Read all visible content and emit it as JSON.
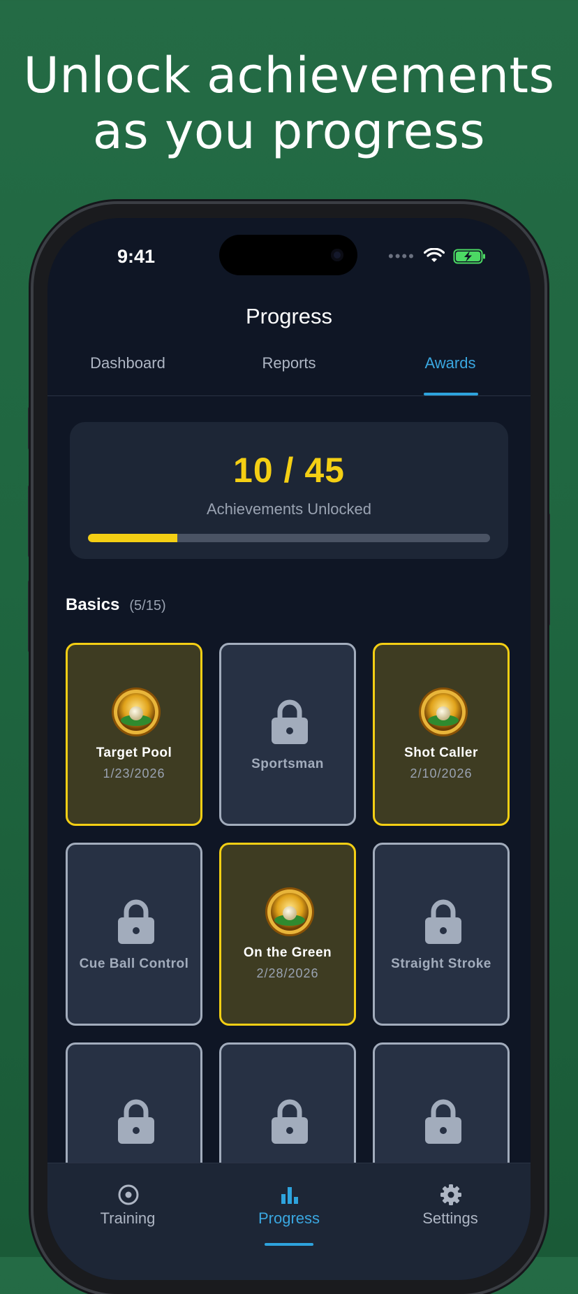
{
  "promo": {
    "line1": "Unlock achievements",
    "line2": "as you progress"
  },
  "status": {
    "time": "9:41"
  },
  "nav": {
    "title": "Progress"
  },
  "tabs": [
    {
      "label": "Dashboard",
      "active": false
    },
    {
      "label": "Reports",
      "active": false
    },
    {
      "label": "Awards",
      "active": true
    }
  ],
  "summary": {
    "count": "10 / 45",
    "label": "Achievements Unlocked",
    "progress": 0.222
  },
  "section": {
    "title": "Basics",
    "count": "(5/15)"
  },
  "achievements": [
    {
      "title": "Target Pool",
      "date": "1/23/2026",
      "unlocked": true
    },
    {
      "title": "Sportsman",
      "date": "",
      "unlocked": false
    },
    {
      "title": "Shot Caller",
      "date": "2/10/2026",
      "unlocked": true
    },
    {
      "title": "Cue Ball Control",
      "date": "",
      "unlocked": false
    },
    {
      "title": "On the Green",
      "date": "2/28/2026",
      "unlocked": true
    },
    {
      "title": "Straight Stroke",
      "date": "",
      "unlocked": false
    },
    {
      "title": "",
      "date": "",
      "unlocked": false
    },
    {
      "title": "",
      "date": "",
      "unlocked": false
    },
    {
      "title": "",
      "date": "",
      "unlocked": false
    }
  ],
  "tabbar": [
    {
      "label": "Training",
      "icon": "target-icon",
      "active": false
    },
    {
      "label": "Progress",
      "icon": "bar-chart-icon",
      "active": true
    },
    {
      "label": "Settings",
      "icon": "gear-icon",
      "active": false
    }
  ],
  "colors": {
    "accent": "#2ea3dd",
    "gold": "#f4cf14",
    "background": "#0f1625"
  }
}
